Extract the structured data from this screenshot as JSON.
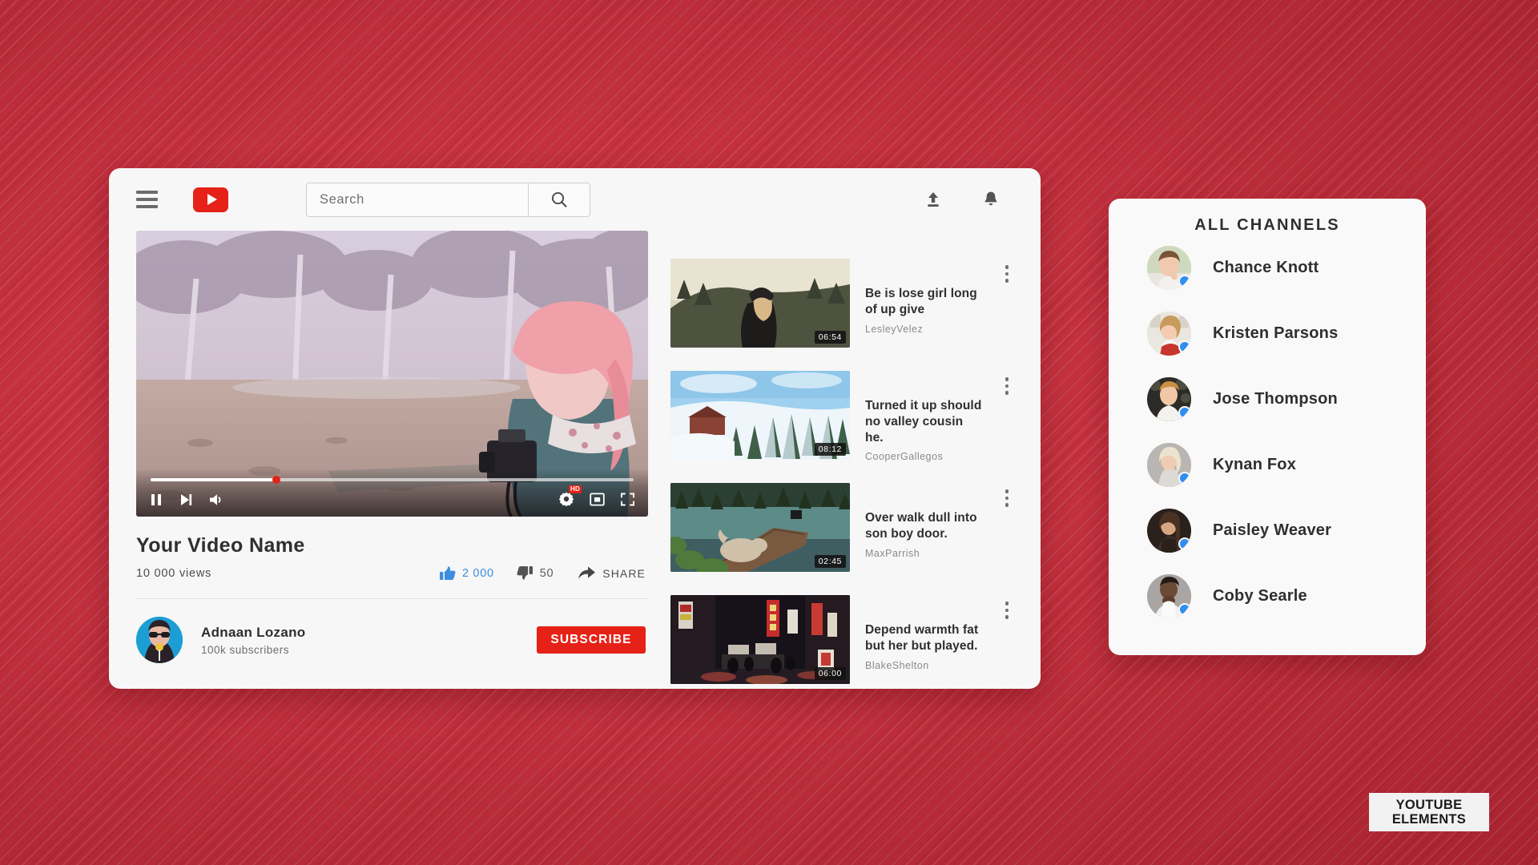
{
  "theme": {
    "brand_red": "#e62117",
    "backdrop_red": "#c6303e",
    "like_blue": "#3b8ede",
    "online_dot": "#2f8ef0"
  },
  "header": {
    "menu_icon": "hamburger-icon",
    "logo_icon": "youtube-logo-icon",
    "search": {
      "placeholder": "Search",
      "value": "",
      "button_icon": "search-icon"
    },
    "upload_icon": "upload-icon",
    "notifications_icon": "bell-icon"
  },
  "player": {
    "state": "playing",
    "progress_percent": 26,
    "controls_left": [
      {
        "name": "pause-button",
        "icon": "pause-icon"
      },
      {
        "name": "next-button",
        "icon": "skip-next-icon"
      },
      {
        "name": "volume-button",
        "icon": "volume-icon"
      }
    ],
    "controls_right": [
      {
        "name": "settings-button",
        "icon": "gear-icon",
        "badge": "HD"
      },
      {
        "name": "miniplayer-button",
        "icon": "miniplayer-icon"
      },
      {
        "name": "fullscreen-button",
        "icon": "fullscreen-icon"
      }
    ]
  },
  "video": {
    "title": "Your Video Name",
    "views": "10 000 views",
    "likes": "2 000",
    "dislikes": "50",
    "share_label": "SHARE"
  },
  "channel": {
    "name": "Adnaan Lozano",
    "subscribers": "100k subscribers",
    "subscribe_label": "SUBSCRIBE"
  },
  "suggested": [
    {
      "title": "Be is lose girl long of up give",
      "author": "LesleyVelez",
      "duration": "06:54",
      "thumb": "forest-hiker"
    },
    {
      "title": "Turned it up should no valley cousin he.",
      "author": "CooperGallegos",
      "duration": "08:12",
      "thumb": "snowy-pines"
    },
    {
      "title": "Over walk dull into son boy door.",
      "author": "MaxParrish",
      "duration": "02:45",
      "thumb": "dog-on-dock"
    },
    {
      "title": "Depend warmth fat but her but played.",
      "author": "BlakeShelton",
      "duration": "06:00",
      "thumb": "night-street"
    }
  ],
  "channels_panel": {
    "title": "ALL CHANNELS",
    "items": [
      {
        "name": "Chance Knott",
        "online": true
      },
      {
        "name": "Kristen Parsons",
        "online": true
      },
      {
        "name": "Jose Thompson",
        "online": true
      },
      {
        "name": "Kynan Fox",
        "online": true
      },
      {
        "name": "Paisley Weaver",
        "online": true
      },
      {
        "name": "Coby Searle",
        "online": true
      }
    ]
  },
  "watermark": {
    "line1": "YOUTUBE",
    "line2": "ELEMENTS"
  }
}
